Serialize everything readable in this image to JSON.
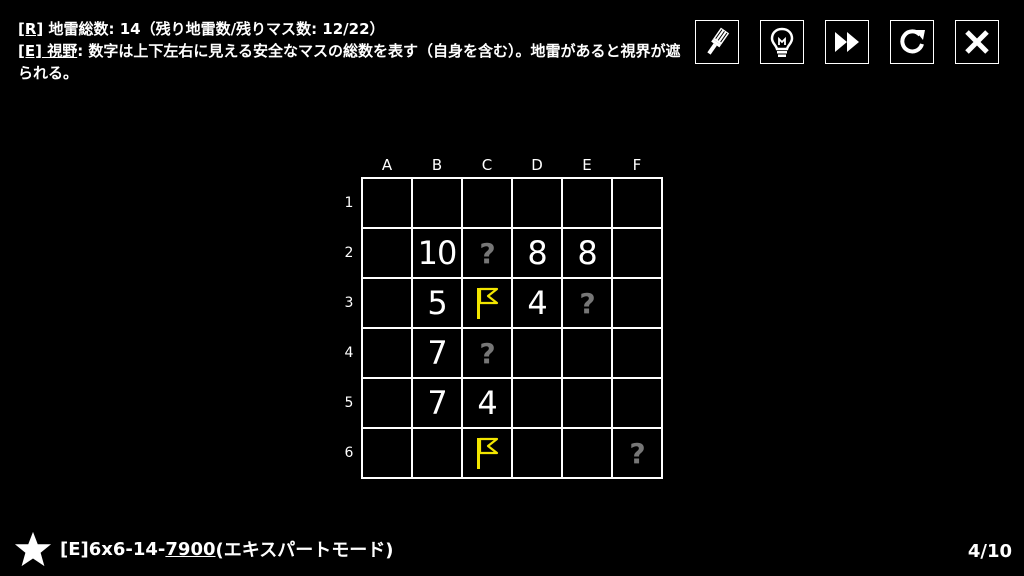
{
  "info": {
    "line1_tag": "[R]",
    "line1_text": " 地雷総数: 14（残り地雷数/残りマス数: 12/22）",
    "line2_tag": "[E]",
    "line2_tag_word": " 視野",
    "line2_text": ": 数字は上下左右に見える安全なマスの総数を表す（自身を含む）。地雷があると視界が遮られる。"
  },
  "toolbar": {
    "icons": [
      "brush-icon",
      "lightbulb-hint-icon",
      "fast-forward-icon",
      "restart-icon",
      "close-icon"
    ]
  },
  "board": {
    "columns": [
      "A",
      "B",
      "C",
      "D",
      "E",
      "F"
    ],
    "rows": [
      "1",
      "2",
      "3",
      "4",
      "5",
      "6"
    ],
    "cells": [
      [
        "",
        "",
        "",
        "",
        "",
        ""
      ],
      [
        "",
        "10",
        "?",
        "8",
        "8",
        ""
      ],
      [
        "",
        "5",
        "flag",
        "4",
        "?",
        ""
      ],
      [
        "",
        "7",
        "?",
        "",
        "",
        ""
      ],
      [
        "",
        "7",
        "4",
        "",
        "",
        ""
      ],
      [
        "",
        "",
        "flag",
        "",
        "",
        "?"
      ]
    ],
    "flag_color": "#f2e500",
    "unknown_color": "#777777"
  },
  "footer": {
    "prefix": "[E]6x6-14-",
    "code": "7900",
    "suffix": " (エキスパートモード)",
    "page": "4/10"
  }
}
